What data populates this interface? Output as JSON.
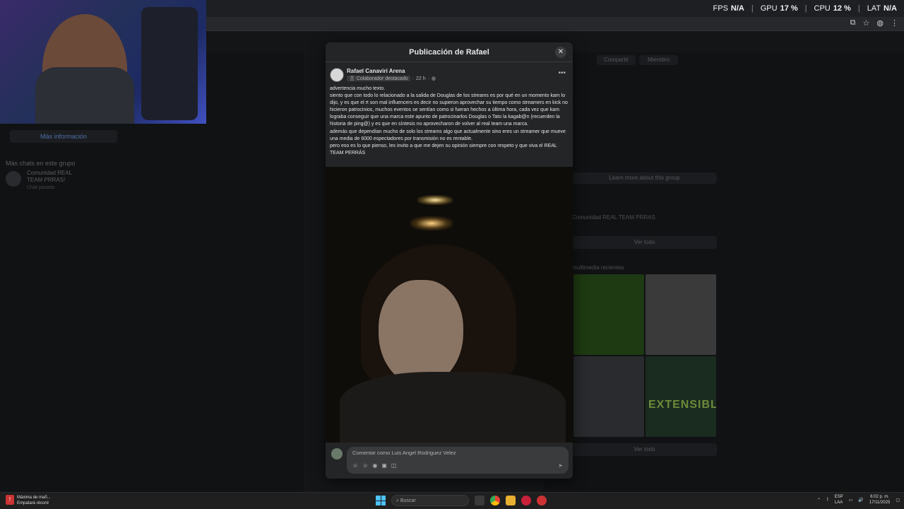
{
  "overlay": {
    "stats": [
      {
        "label": "FPS",
        "value": "N/A"
      },
      {
        "label": "GPU",
        "value": "17 %"
      },
      {
        "label": "CPU",
        "value": "12 %"
      },
      {
        "label": "LAT",
        "value": "N/A"
      }
    ]
  },
  "background": {
    "left": {
      "more_button": "Más información",
      "chats_title": "Más chats en este grupo",
      "chat_name": "Comunidad REAL TEAM PRRAS!",
      "chat_sub": "Chat pasado"
    },
    "right": {
      "share_button": "Compartir",
      "members_button": "Miembro",
      "learn_more": "Learn more about this group",
      "chat_name": "Comunidad REAL TEAM PRRAS",
      "see_all_1": "Ver todo",
      "media_title": "multimedia recientes",
      "see_all_2": "Ver todo",
      "media_text": "EXTENSIBLE"
    }
  },
  "modal": {
    "title": "Publicación de Rafael",
    "author": {
      "name": "Rafael Canaviri Arena",
      "badge": "Colaborador destacado",
      "time": "22 h"
    },
    "post_lines": [
      "advertencia mucho texto.",
      "siento que con todo lo relacionado a la salida de Douglas de los streams es por qué en un momento kam lo dijo, y es que el rt son mal influencers es decir no supieron aprovechar su tiempo como streamers en kick no hicieron patrocinios, muchos eventos se sentían como si fueran hechos a última hora, cada vez que kam lograba conseguir que una marca este apunto de patrocinarlos Douglas o Tato la kagab@n (recuerden la historia de ping@) y es que en síntesis no aprovecharon de volver al real team una marca.",
      "además que dependían mucho de solo los streams algo que actualmente sino eres un streamer que mueve una media de 6000 espectadores por transmisión no es rentable.",
      "pero eso es lo que pienso, les invito a que me dejen su opinión siempre con respeto y que viva el REAL TEAM PERRÁS"
    ],
    "comment_placeholder": "Comentar como Luis Angel Rodriguez Velez"
  },
  "taskbar": {
    "notification_title": "Máxima de mañ...",
    "notification_sub": "Empatará récord",
    "search_placeholder": "Buscar",
    "lang": "ESP",
    "lang_sub": "LAA",
    "time": "6:02 p. m.",
    "date": "17/11/2025"
  }
}
